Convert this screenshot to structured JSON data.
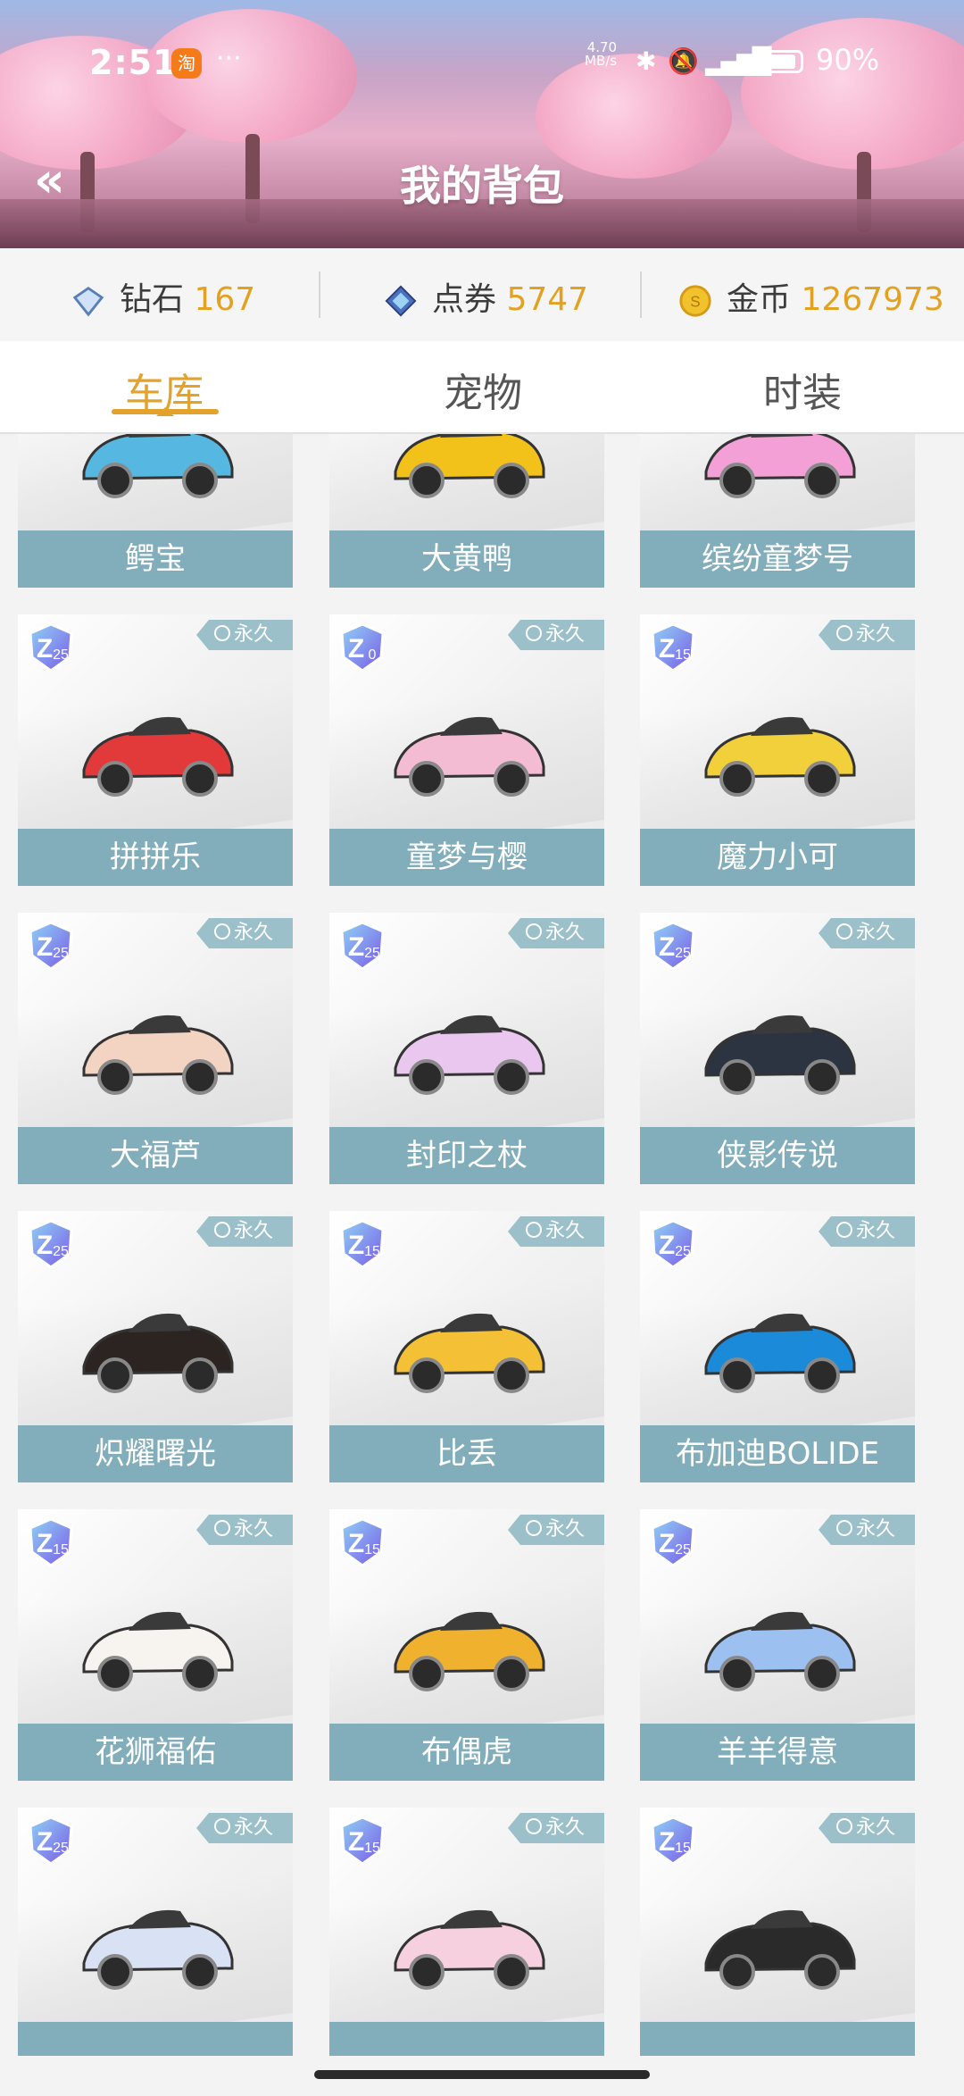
{
  "status_bar": {
    "time": "2:51",
    "taobao": "淘",
    "dots": "···",
    "net_speed": "4.70",
    "net_unit": "MB/s",
    "battery": "90%"
  },
  "header": {
    "title": "我的背包",
    "back_icon": "double-chevron-left-icon"
  },
  "currency": {
    "diamond": {
      "label": "钻石",
      "value": "167"
    },
    "voucher": {
      "label": "点券",
      "value": "5747"
    },
    "gold": {
      "label": "金币",
      "value": "1267973"
    }
  },
  "tabs": [
    "车库",
    "宠物",
    "时装"
  ],
  "badge_label": "永久",
  "items": [
    {
      "name": "鳄宝",
      "level": "",
      "color": "#56b7e0"
    },
    {
      "name": "大黄鸭",
      "level": "",
      "color": "#f2c21b"
    },
    {
      "name": "缤纷童梦号",
      "level": "",
      "color": "#f3a0d6"
    },
    {
      "name": "拼拼乐",
      "level": "25",
      "color": "#e23a3a"
    },
    {
      "name": "童梦与樱",
      "level": "0",
      "color": "#f4bcd2"
    },
    {
      "name": "魔力小可",
      "level": "15",
      "color": "#f2d03b"
    },
    {
      "name": "大福芦",
      "level": "25",
      "color": "#f3d3c2"
    },
    {
      "name": "封印之杖",
      "level": "25",
      "color": "#e9c7ef"
    },
    {
      "name": "侠影传说",
      "level": "25",
      "color": "#2d3441"
    },
    {
      "name": "炽耀曙光",
      "level": "25",
      "color": "#2b2421"
    },
    {
      "name": "比丢",
      "level": "15",
      "color": "#f4c035"
    },
    {
      "name": "布加迪BOLIDE",
      "level": "25",
      "color": "#1b8bd9"
    },
    {
      "name": "花狮福佑",
      "level": "15",
      "color": "#f7f3ef"
    },
    {
      "name": "布偶虎",
      "level": "15",
      "color": "#f0b22e"
    },
    {
      "name": "羊羊得意",
      "level": "25",
      "color": "#9cc0f0"
    },
    {
      "name": "",
      "level": "25",
      "color": "#d9e1f5"
    },
    {
      "name": "",
      "level": "15",
      "color": "#f7d0df"
    },
    {
      "name": "",
      "level": "15",
      "color": "#2a2a2a"
    }
  ]
}
